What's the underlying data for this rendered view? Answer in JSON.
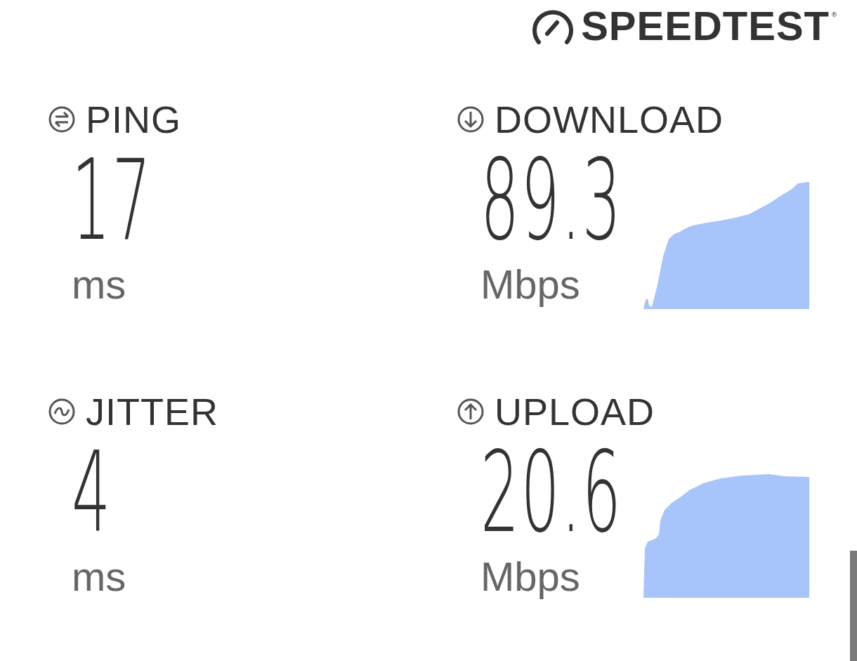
{
  "logo": {
    "text": "SPEEDTEST",
    "mark": "®"
  },
  "metrics": [
    {
      "kind": "ping",
      "label": "PING",
      "value": "17",
      "unit": "ms"
    },
    {
      "kind": "download",
      "label": "DOWNLOAD",
      "value": "89.3",
      "unit": "Mbps"
    },
    {
      "kind": "jitter",
      "label": "JITTER",
      "value": "4",
      "unit": "ms"
    },
    {
      "kind": "upload",
      "label": "UPLOAD",
      "value": "20.6",
      "unit": "Mbps"
    }
  ]
}
